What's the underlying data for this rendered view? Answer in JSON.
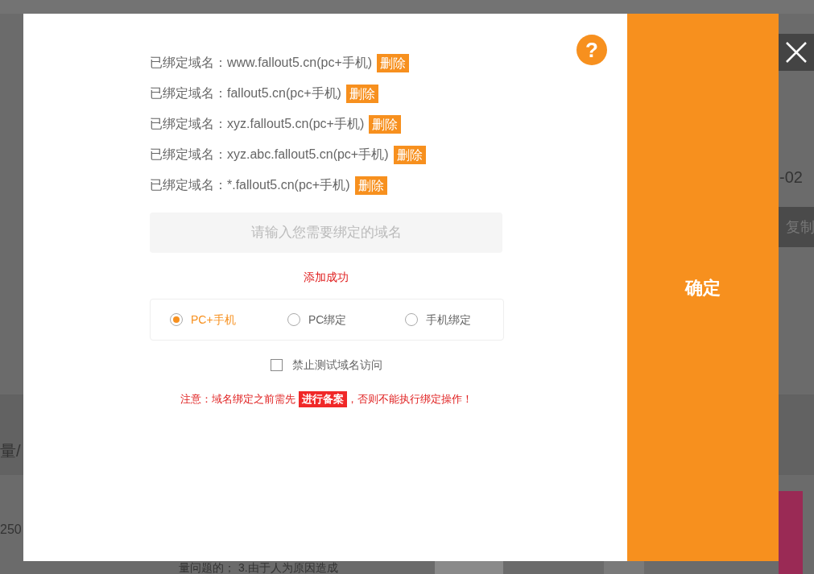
{
  "background": {
    "date_fragment": "-02",
    "copy_button": "复制",
    "column_fragment": "量/",
    "cell_fragment": "250",
    "text_fragment": "量问题的； 3.由于人为原因造成"
  },
  "dialog": {
    "help": "?",
    "domains": [
      {
        "prefix": "已绑定域名：",
        "domain": "www.fallout5.cn(pc+手机)",
        "action": "删除"
      },
      {
        "prefix": "已绑定域名：",
        "domain": "fallout5.cn(pc+手机)",
        "action": "删除"
      },
      {
        "prefix": "已绑定域名：",
        "domain": "xyz.fallout5.cn(pc+手机)",
        "action": "删除"
      },
      {
        "prefix": "已绑定域名：",
        "domain": "xyz.abc.fallout5.cn(pc+手机)",
        "action": "删除"
      },
      {
        "prefix": "已绑定域名：",
        "domain": "*.fallout5.cn(pc+手机)",
        "action": "删除"
      }
    ],
    "input": {
      "placeholder": "请输入您需要绑定的域名"
    },
    "message": "添加成功",
    "modes": [
      {
        "label": "PC+手机",
        "selected": true
      },
      {
        "label": "PC绑定",
        "selected": false
      },
      {
        "label": "手机绑定",
        "selected": false
      }
    ],
    "checkbox": {
      "label": "禁止测试域名访问",
      "checked": false
    },
    "notice": {
      "before": "注意：域名绑定之前需先",
      "link": "进行备案",
      "after": "，否则不能执行绑定操作！"
    },
    "confirm": "确定"
  }
}
